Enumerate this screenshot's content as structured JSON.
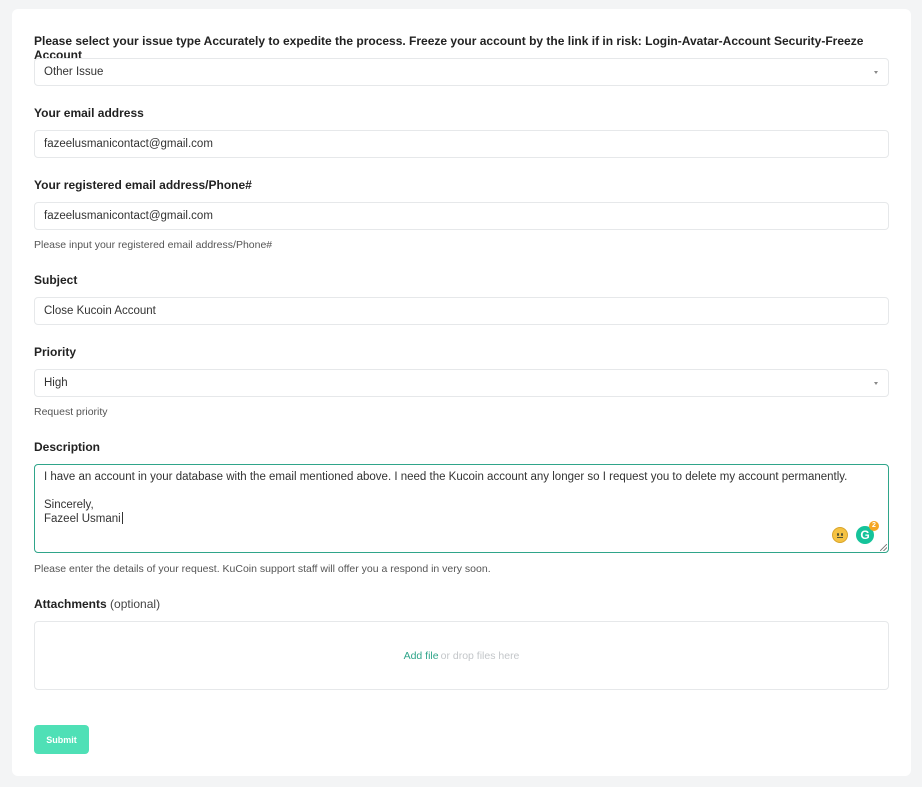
{
  "issue_type": {
    "label": "Please select your issue type Accurately to expedite the process. Freeze your account by the link if in risk: Login-Avatar-Account Security-Freeze Account",
    "value": "Other Issue"
  },
  "email": {
    "label": "Your email address",
    "value": "fazeelusmanicontact@gmail.com"
  },
  "registered": {
    "label": "Your registered email address/Phone#",
    "value": "fazeelusmanicontact@gmail.com",
    "hint": "Please input your registered email address/Phone#"
  },
  "subject": {
    "label": "Subject",
    "value": "Close Kucoin Account"
  },
  "priority": {
    "label": "Priority",
    "value": "High",
    "hint": "Request priority"
  },
  "description": {
    "label": "Description",
    "line1": "I have an account in your database with the email mentioned above. I need the Kucoin account any longer so I request you to delete my account permanently.",
    "line2": "Sincerely,",
    "line3": "Fazeel Usmani",
    "hint": "Please enter the details of your request. KuCoin support staff will offer you a respond in very soon.",
    "grammarly_count": "2"
  },
  "attachments": {
    "label": "Attachments",
    "optional": "(optional)",
    "add_file": "Add file",
    "drop_text": "or drop files here"
  },
  "submit_label": "Submit",
  "icons": {
    "select_caret": "chevron-down-icon",
    "emoji": "neutral-face-icon",
    "grammarly": "grammarly-icon"
  },
  "colors": {
    "accent": "#2fa58a",
    "submit": "#4fe0b6",
    "grammarly": "#15c39a"
  }
}
